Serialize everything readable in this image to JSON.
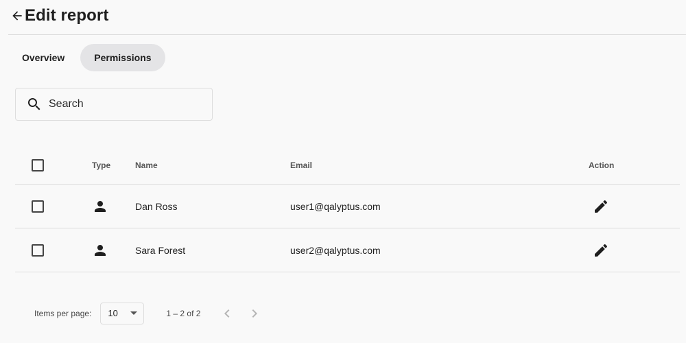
{
  "header": {
    "title": "Edit report",
    "back_icon": "arrow-left-icon"
  },
  "tabs": [
    {
      "label": "Overview",
      "active": false
    },
    {
      "label": "Permissions",
      "active": true
    }
  ],
  "search": {
    "placeholder": "Search",
    "value": "",
    "icon": "search-icon"
  },
  "table": {
    "columns": {
      "select": "",
      "type": "Type",
      "name": "Name",
      "email": "Email",
      "action": "Action"
    },
    "rows": [
      {
        "type_icon": "person-icon",
        "name": "Dan Ross",
        "email": "user1@qalyptus.com",
        "action_icon": "pencil-icon",
        "checked": false
      },
      {
        "type_icon": "person-icon",
        "name": "Sara Forest",
        "email": "user2@qalyptus.com",
        "action_icon": "pencil-icon",
        "checked": false
      }
    ]
  },
  "paginator": {
    "items_per_page_label": "Items per page:",
    "items_per_page_value": "10",
    "range_label": "1 – 2 of 2",
    "prev_icon": "chevron-left-icon",
    "next_icon": "chevron-right-icon"
  },
  "colors": {
    "background": "#f9f9f9",
    "active_tab": "#e4e4e6",
    "text": "#1f1f1f",
    "divider": "#dcdcdc"
  }
}
